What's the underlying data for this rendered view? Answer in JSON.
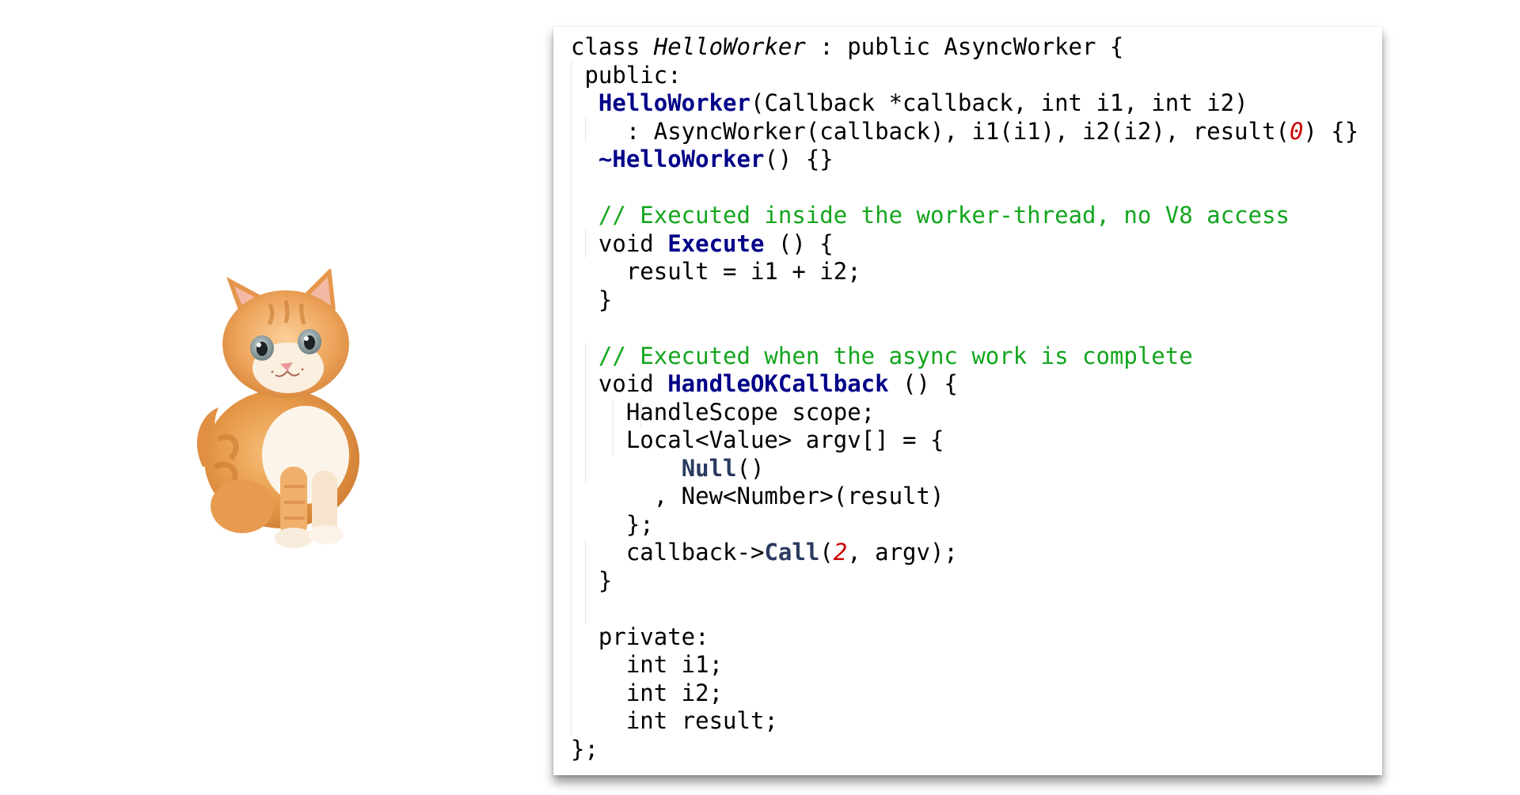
{
  "code": {
    "lines": [
      [
        {
          "t": "class "
        },
        {
          "t": "HelloWorker",
          "c": "it"
        },
        {
          "t": " : public AsyncWorker {"
        }
      ],
      [
        {
          "t": " public:"
        }
      ],
      [
        {
          "t": "  "
        },
        {
          "t": "HelloWorker",
          "c": "fn"
        },
        {
          "t": "(Callback *callback, int i1, int i2)"
        }
      ],
      [
        {
          "t": "    : AsyncWorker(callback), i1(i1), i2(i2), result("
        },
        {
          "t": "0",
          "c": "num"
        },
        {
          "t": ") {}"
        }
      ],
      [
        {
          "t": "  "
        },
        {
          "t": "~HelloWorker",
          "c": "fn"
        },
        {
          "t": "() {}"
        }
      ],
      [
        {
          "t": ""
        }
      ],
      [
        {
          "t": "  "
        },
        {
          "t": "// Executed inside the worker-thread, no V8 access",
          "c": "cm"
        }
      ],
      [
        {
          "t": "  void "
        },
        {
          "t": "Execute",
          "c": "fn"
        },
        {
          "t": " () {"
        }
      ],
      [
        {
          "t": "    result = i1 + i2;"
        }
      ],
      [
        {
          "t": "  }"
        }
      ],
      [
        {
          "t": ""
        }
      ],
      [
        {
          "t": "  "
        },
        {
          "t": "// Executed when the async work is complete",
          "c": "cm"
        }
      ],
      [
        {
          "t": "  void "
        },
        {
          "t": "HandleOKCallback",
          "c": "fn"
        },
        {
          "t": " () {"
        }
      ],
      [
        {
          "t": "    HandleScope scope;"
        }
      ],
      [
        {
          "t": "    Local<Value> argv[] = {"
        }
      ],
      [
        {
          "t": "        "
        },
        {
          "t": "Null",
          "c": "ident"
        },
        {
          "t": "()"
        }
      ],
      [
        {
          "t": "      , New<Number>(result)"
        }
      ],
      [
        {
          "t": "    };"
        }
      ],
      [
        {
          "t": "    callback->"
        },
        {
          "t": "Call",
          "c": "ident"
        },
        {
          "t": "("
        },
        {
          "t": "2",
          "c": "num"
        },
        {
          "t": ", argv);"
        }
      ],
      [
        {
          "t": "  }"
        }
      ],
      [
        {
          "t": ""
        }
      ],
      [
        {
          "t": "  private:"
        }
      ],
      [
        {
          "t": "    int i1;"
        }
      ],
      [
        {
          "t": "    int i2;"
        }
      ],
      [
        {
          "t": "    int result;"
        }
      ],
      [
        {
          "t": "};"
        }
      ]
    ]
  },
  "colors": {
    "function_name": "#000088",
    "identifier": "#2a3a60",
    "number_literal": "#cc0000",
    "comment": "#13a51d",
    "text": "#000000"
  },
  "icons": {
    "kitten": "kitten-photo"
  }
}
